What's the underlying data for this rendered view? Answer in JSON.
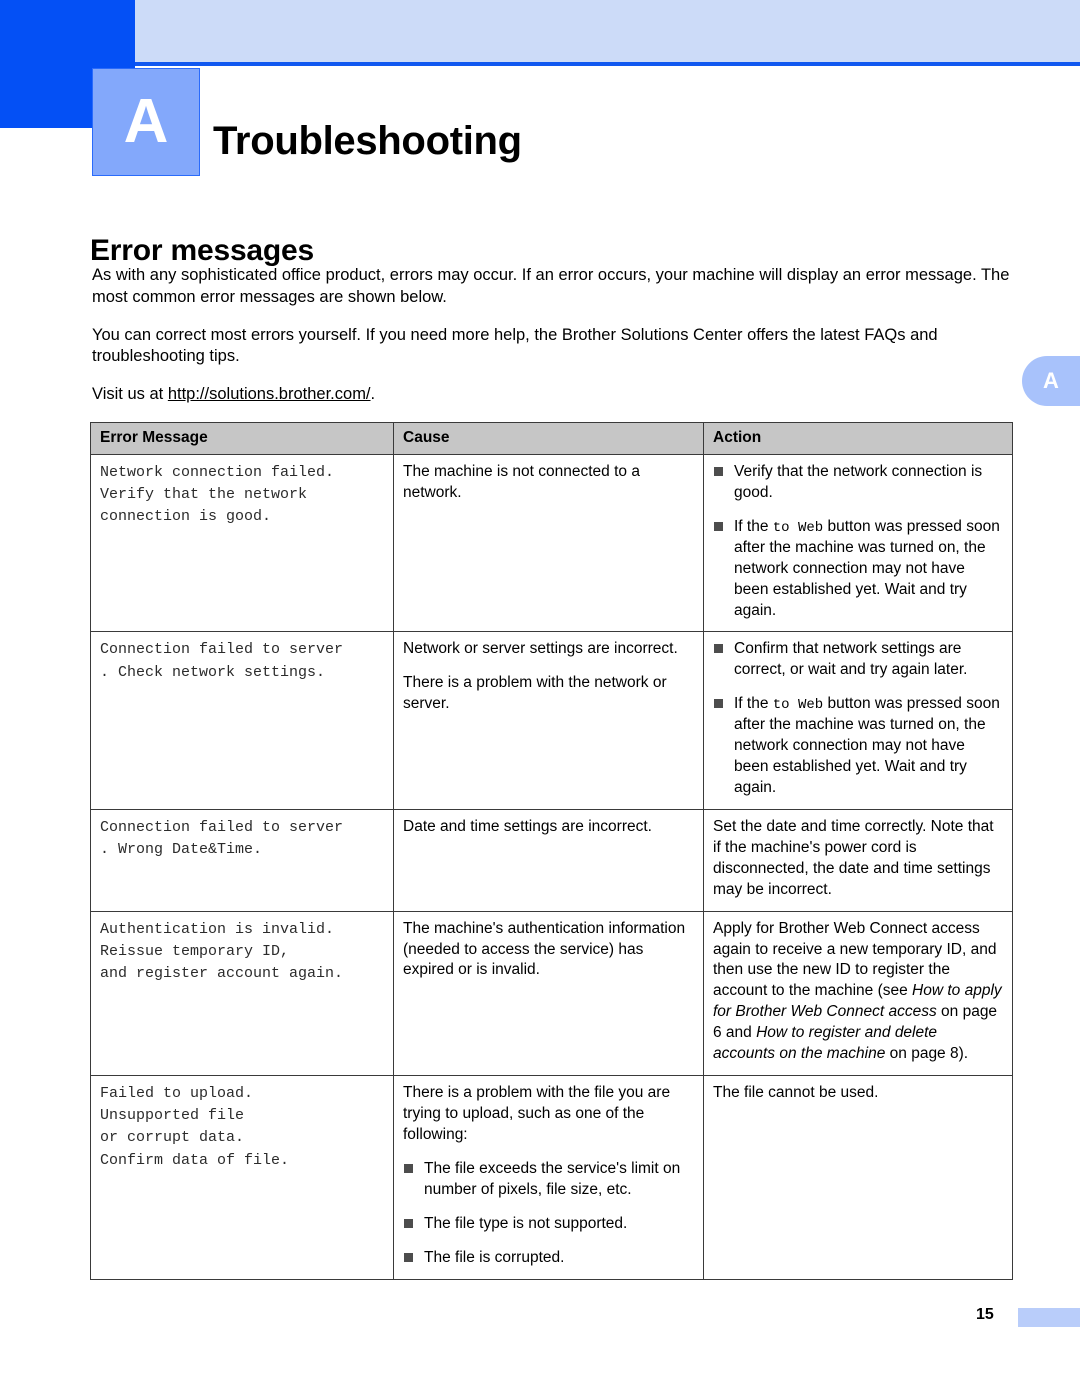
{
  "banner": {
    "chapter_letter": "A",
    "chapter_title": "Troubleshooting",
    "side_tab_letter": "A"
  },
  "section": {
    "heading": "Error messages"
  },
  "intro": {
    "paragraph1": "As with any sophisticated office product, errors may occur. If an error occurs, your machine will display an error message. The most common error messages are shown below.",
    "paragraph2": "You can correct most errors yourself. If you need more help, the Brother Solutions Center offers the latest FAQs and troubleshooting tips.",
    "paragraph3_prefix": "Visit us at ",
    "paragraph3_url": "http://solutions.brother.com/",
    "paragraph3_suffix": "."
  },
  "table": {
    "headers": {
      "error_message": "Error Message",
      "cause": "Cause",
      "action": "Action"
    },
    "rows": [
      {
        "error_message": "Network connection failed.\nVerify that the network\nconnection is good.",
        "cause_paragraphs": [
          "The machine is not connected to a network."
        ],
        "action_bullets": [
          {
            "pre": "Verify that the network connection is good.",
            "mono": "",
            "post": ""
          },
          {
            "pre": "If the ",
            "mono": "to Web",
            "post": " button was pressed soon after the machine was turned on, the network connection may not have been established yet. Wait and try again."
          }
        ]
      },
      {
        "error_message": "Connection failed to server\n. Check network settings.",
        "cause_paragraphs": [
          "Network or server settings are incorrect.",
          "There is a problem with the network or server."
        ],
        "action_bullets": [
          {
            "pre": "Confirm that network settings are correct, or wait and try again later.",
            "mono": "",
            "post": ""
          },
          {
            "pre": "If the ",
            "mono": "to Web",
            "post": " button was pressed soon after the machine was turned on, the network connection may not have been established yet. Wait and try again."
          }
        ]
      },
      {
        "error_message": "Connection failed to server\n. Wrong Date&Time.",
        "cause_paragraphs": [
          "Date and time settings are incorrect."
        ],
        "action_plain": "Set the date and time correctly. Note that if the machine's power cord is disconnected, the date and time settings may be incorrect."
      },
      {
        "error_message": "Authentication is invalid.\nReissue temporary ID,\nand register account again.",
        "cause_paragraphs": [
          "The machine's authentication information (needed to access the service) has expired or is invalid."
        ],
        "action_rich": {
          "part1": "Apply for Brother Web Connect access again to receive a new temporary ID, and then use the new ID to register the account to the machine (see ",
          "italic1": "How to apply for Brother Web Connect access",
          "part2": " on page 6 and ",
          "italic2": "How to register and delete accounts on the machine",
          "part3": " on page 8)."
        }
      },
      {
        "error_message": "Failed to upload.\nUnsupported file\nor corrupt data.\nConfirm data of file.",
        "cause_paragraphs": [
          "There is a problem with the file you are trying to upload, such as one of the following:"
        ],
        "cause_bullets": [
          "The file exceeds the service's limit on number of pixels, file size, etc.",
          "The file type is not supported.",
          "The file is corrupted."
        ],
        "action_plain": "The file cannot be used."
      }
    ]
  },
  "footer": {
    "page_number": "15"
  }
}
